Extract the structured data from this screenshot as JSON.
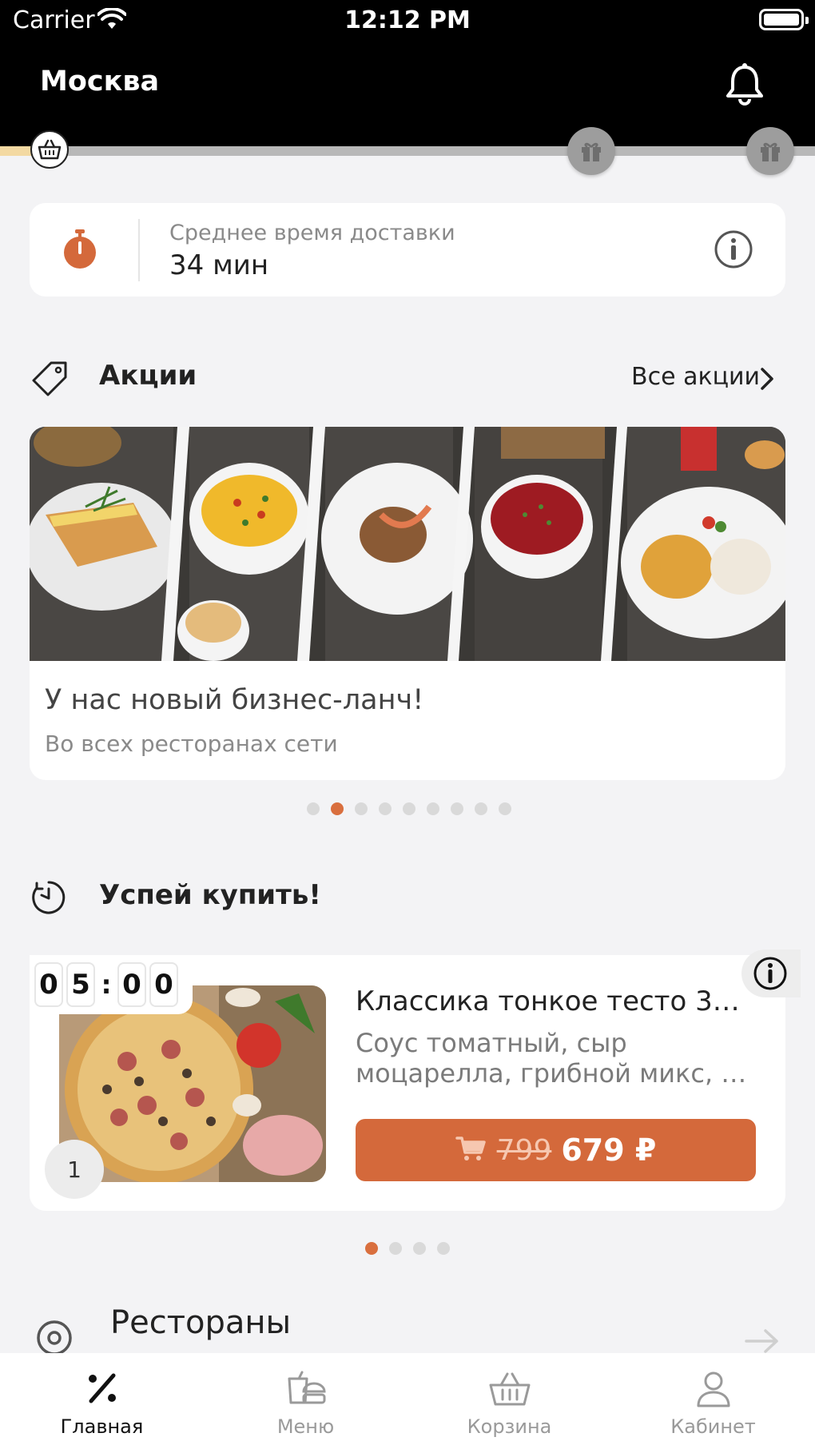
{
  "status_bar": {
    "carrier": "Carrier",
    "time": "12:12 PM"
  },
  "header": {
    "city": "Москва"
  },
  "loyalty_progress": {
    "fraction": 0.04
  },
  "delivery": {
    "label": "Среднее время доставки",
    "value": "34 мин"
  },
  "promos": {
    "title": "Акции",
    "all_link": "Все акции",
    "card": {
      "title": "У нас новый бизнес-ланч!",
      "subtitle": "Во всех ресторанах сети"
    },
    "pager": {
      "count": 9,
      "active": 1
    }
  },
  "hurry": {
    "title": "Успей купить!",
    "countdown": [
      "0",
      "5",
      ":",
      "0",
      "0"
    ],
    "product": {
      "title": "Классика тонкое тесто 36…",
      "desc_line1": "Соус томатный, сыр",
      "desc_line2": "моцарелла, грибной микс, в…",
      "old_price": "799",
      "new_price": "679 ₽",
      "quantity": "1"
    },
    "pager": {
      "count": 4,
      "active": 0
    }
  },
  "restaurants": {
    "title": "Рестораны"
  },
  "tabs": [
    {
      "label": "Главная",
      "icon": "percent-icon",
      "active": true
    },
    {
      "label": "Меню",
      "icon": "menu-food-icon",
      "active": false
    },
    {
      "label": "Корзина",
      "icon": "basket-icon",
      "active": false
    },
    {
      "label": "Кабинет",
      "icon": "profile-icon",
      "active": false
    }
  ],
  "colors": {
    "accent": "#d4693b",
    "header_bg": "#000000",
    "background": "#f3f3f5"
  }
}
